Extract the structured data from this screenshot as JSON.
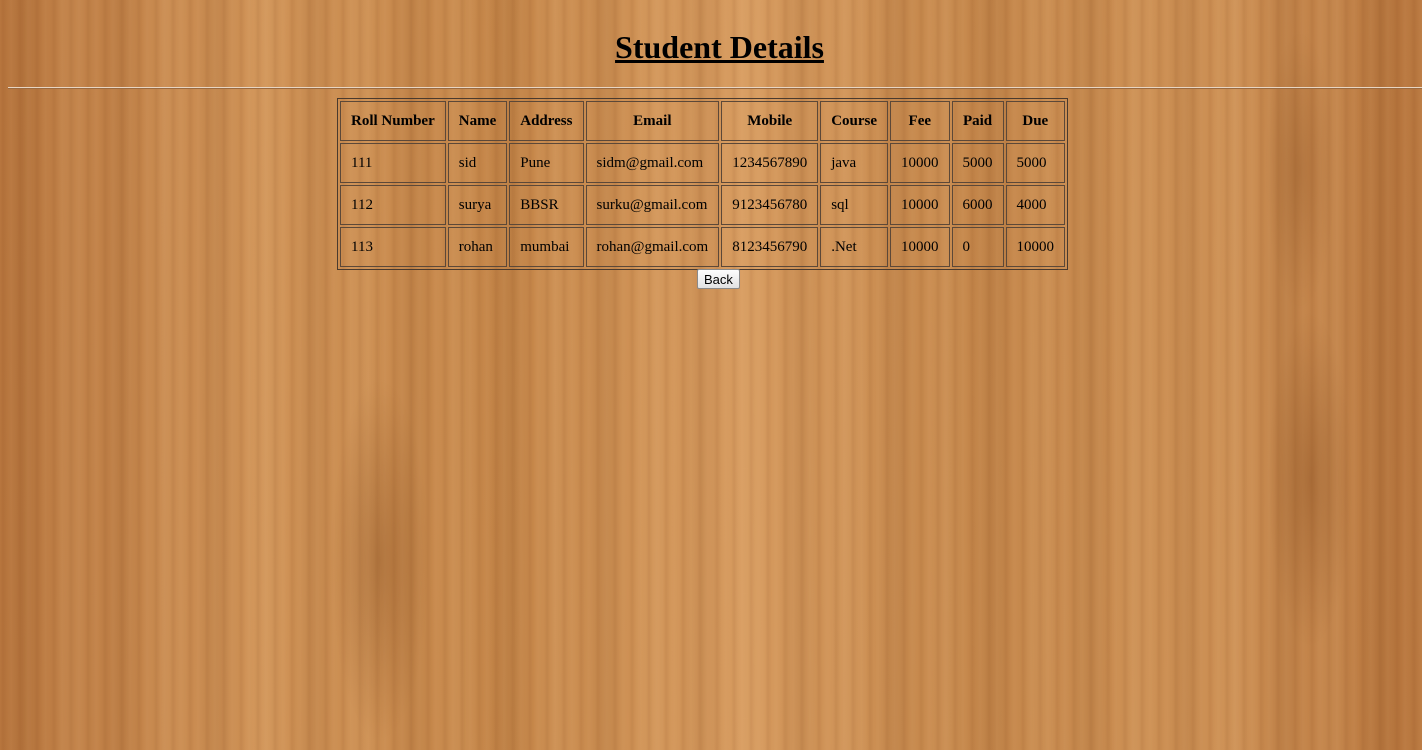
{
  "page": {
    "title": "Student Details"
  },
  "table": {
    "headers": [
      "Roll Number",
      "Name",
      "Address",
      "Email",
      "Mobile",
      "Course",
      "Fee",
      "Paid",
      "Due"
    ],
    "rows": [
      [
        "111",
        "sid",
        "Pune",
        "sidm@gmail.com",
        "1234567890",
        "java",
        "10000",
        "5000",
        "5000"
      ],
      [
        "112",
        "surya",
        "BBSR",
        "surku@gmail.com",
        "9123456780",
        "sql",
        "10000",
        "6000",
        "4000"
      ],
      [
        "113",
        "rohan",
        "mumbai",
        "rohan@gmail.com",
        "8123456790",
        ".Net",
        "10000",
        "0",
        "10000"
      ]
    ]
  },
  "actions": {
    "back_label": "Back"
  }
}
